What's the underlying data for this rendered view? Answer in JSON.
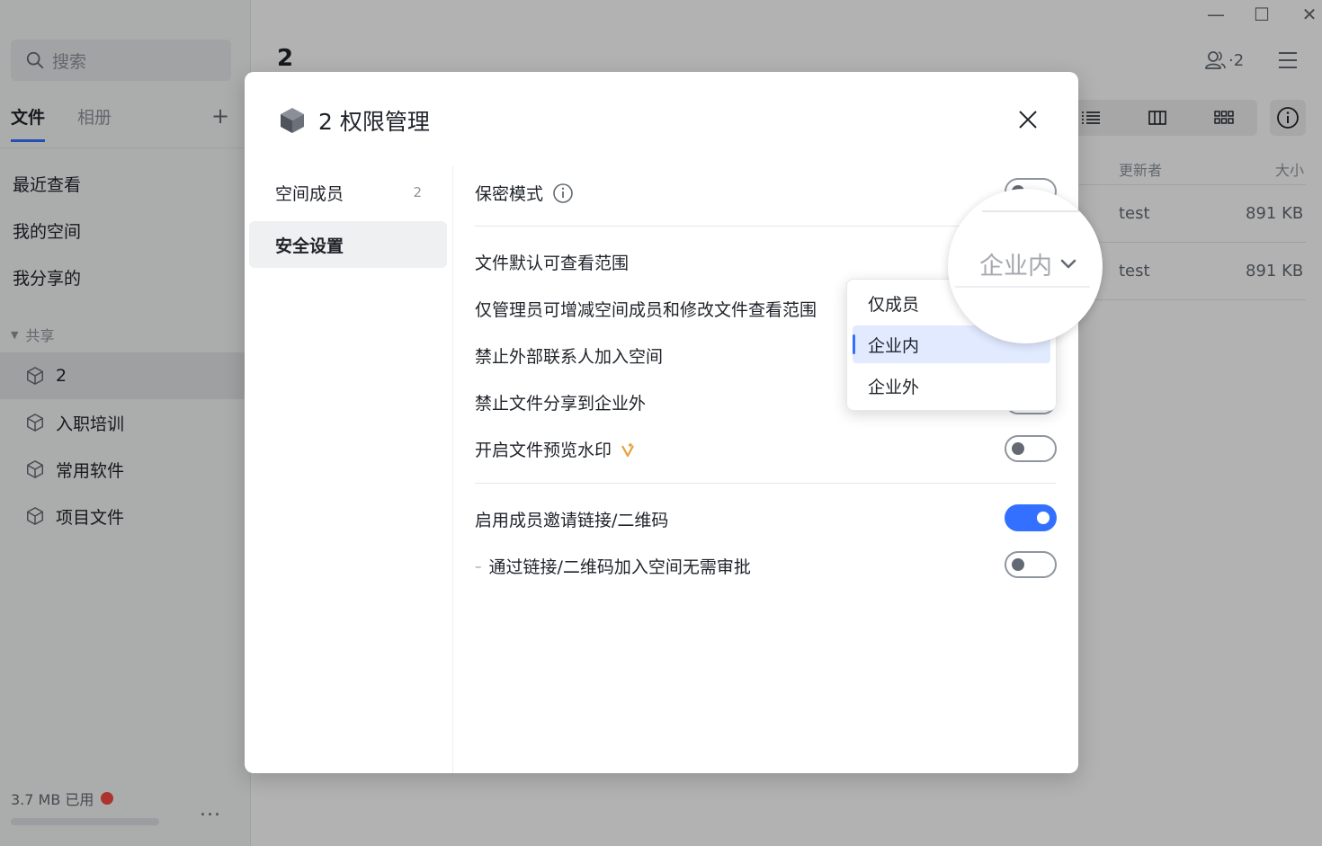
{
  "sidebar": {
    "search_placeholder": "搜索",
    "tabs": [
      {
        "label": "文件"
      },
      {
        "label": "相册"
      }
    ],
    "nav": [
      {
        "label": "最近查看"
      },
      {
        "label": "我的空间"
      },
      {
        "label": "我分享的"
      }
    ],
    "group_label": "共享",
    "spaces": [
      {
        "label": "2"
      },
      {
        "label": "入职培训"
      },
      {
        "label": "常用软件"
      },
      {
        "label": "项目文件"
      }
    ],
    "storage_used": "3.7 MB 已用",
    "more_label": "..."
  },
  "main": {
    "title": "2",
    "member_count": "·2",
    "columns": {
      "updater": "更新者",
      "size": "大小"
    },
    "rows": [
      {
        "updater": "test",
        "size": "891 KB"
      },
      {
        "updater": "test",
        "size": "891 KB"
      }
    ]
  },
  "modal": {
    "title": "2 权限管理",
    "nav": [
      {
        "label": "空间成员",
        "count": "2"
      },
      {
        "label": "安全设置"
      }
    ],
    "settings": {
      "confidential_mode": "保密模式",
      "default_view_scope": "文件默认可查看范围",
      "admin_only": "仅管理员可增减空间成员和修改文件查看范围",
      "block_external": "禁止外部联系人加入空间",
      "block_share_outside": "禁止文件分享到企业外",
      "watermark": "开启文件预览水印",
      "invite_link": "启用成员邀请链接/二维码",
      "no_approval": "通过链接/二维码加入空间无需审批",
      "no_approval_prefix": "–"
    },
    "toggles": {
      "confidential_mode": false,
      "watermark": false,
      "invite_link": true,
      "no_approval": false
    },
    "scope_selected": "企业内",
    "scope_options": [
      {
        "label": "仅成员"
      },
      {
        "label": "企业内"
      },
      {
        "label": "企业外"
      }
    ]
  },
  "colors": {
    "accent": "#3370ff",
    "status_dot": "#f54a45",
    "vip": "#e6a23c"
  }
}
